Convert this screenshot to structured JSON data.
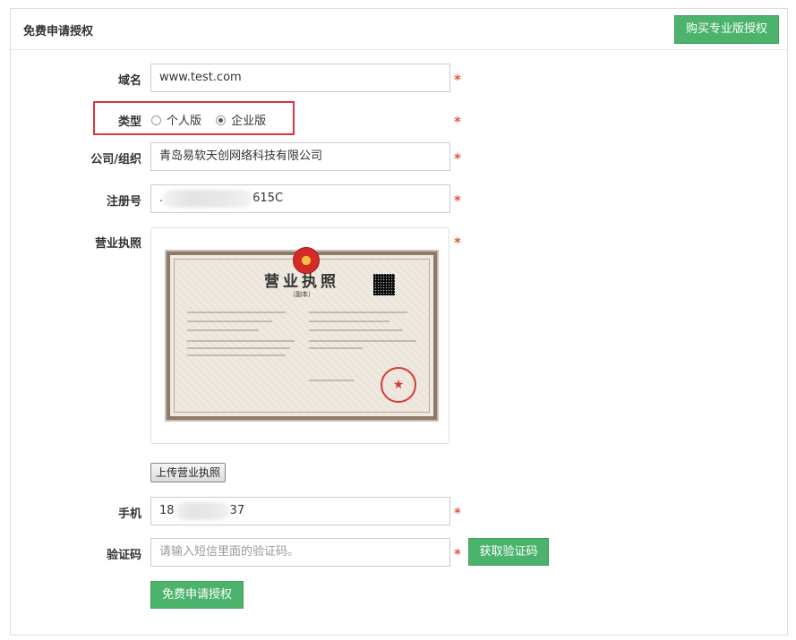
{
  "header": {
    "title": "免费申请授权",
    "buy_label": "购买专业版授权"
  },
  "form": {
    "domain": {
      "label": "域名",
      "value": "www.test.com"
    },
    "type": {
      "label": "类型",
      "options": [
        {
          "label": "个人版",
          "checked": false
        },
        {
          "label": "企业版",
          "checked": true
        }
      ]
    },
    "company": {
      "label": "公司/组织",
      "value": "青岛易软天创网络科技有限公司"
    },
    "reg_no": {
      "label": "注册号",
      "value_start": ".",
      "value_end": "615C"
    },
    "license": {
      "label": "营业执照",
      "cert_title": "营业执照",
      "cert_sub": "（副本）",
      "cert_seal": "★",
      "upload_label": "上传营业执照"
    },
    "phone": {
      "label": "手机",
      "value_start": "18",
      "value_end": "37"
    },
    "captcha": {
      "label": "验证码",
      "placeholder": "请输入短信里面的验证码。",
      "button_label": "获取验证码"
    },
    "required_mark": "*",
    "submit_label": "免费申请授权"
  },
  "colors": {
    "accent_green": "#4cb36c",
    "required_red": "#e05a3a",
    "highlight_red": "#d9363e"
  },
  "icons": [
    "radio-unchecked-icon",
    "radio-checked-icon"
  ]
}
